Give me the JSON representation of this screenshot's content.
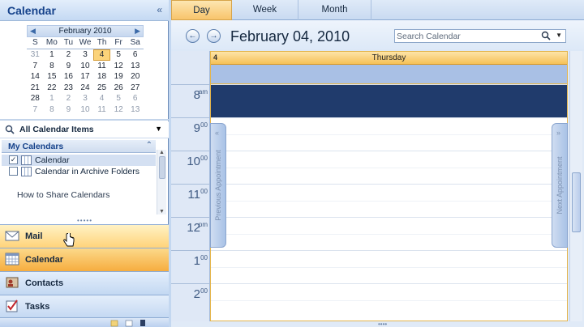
{
  "nav": {
    "title": "Calendar",
    "collapse_glyph": "«",
    "mini_calendar": {
      "month_label": "February 2010",
      "prev_glyph": "◀",
      "next_glyph": "▶",
      "dow": [
        "S",
        "Mo",
        "Tu",
        "We",
        "Th",
        "Fr",
        "Sa"
      ],
      "weeks": [
        [
          {
            "d": "31",
            "o": true
          },
          {
            "d": "1"
          },
          {
            "d": "2"
          },
          {
            "d": "3"
          },
          {
            "d": "4",
            "sel": true
          },
          {
            "d": "5"
          },
          {
            "d": "6"
          }
        ],
        [
          {
            "d": "7"
          },
          {
            "d": "8"
          },
          {
            "d": "9"
          },
          {
            "d": "10"
          },
          {
            "d": "11"
          },
          {
            "d": "12"
          },
          {
            "d": "13"
          }
        ],
        [
          {
            "d": "14"
          },
          {
            "d": "15"
          },
          {
            "d": "16"
          },
          {
            "d": "17"
          },
          {
            "d": "18"
          },
          {
            "d": "19"
          },
          {
            "d": "20"
          }
        ],
        [
          {
            "d": "21"
          },
          {
            "d": "22"
          },
          {
            "d": "23"
          },
          {
            "d": "24"
          },
          {
            "d": "25"
          },
          {
            "d": "26"
          },
          {
            "d": "27"
          }
        ],
        [
          {
            "d": "28"
          },
          {
            "d": "1",
            "o": true
          },
          {
            "d": "2",
            "o": true
          },
          {
            "d": "3",
            "o": true
          },
          {
            "d": "4",
            "o": true
          },
          {
            "d": "5",
            "o": true
          },
          {
            "d": "6",
            "o": true
          }
        ],
        [
          {
            "d": "7",
            "o": true
          },
          {
            "d": "8",
            "o": true
          },
          {
            "d": "9",
            "o": true
          },
          {
            "d": "10",
            "o": true
          },
          {
            "d": "11",
            "o": true
          },
          {
            "d": "12",
            "o": true
          },
          {
            "d": "13",
            "o": true
          }
        ]
      ]
    },
    "all_items_label": "All Calendar Items",
    "all_items_drop": "▼",
    "my_calendars_label": "My Calendars",
    "my_calendars_toggle": "⌃",
    "calendars": [
      {
        "name": "Calendar",
        "checked": "✓"
      },
      {
        "name": "Calendar in Archive Folders",
        "checked": ""
      }
    ],
    "share_link": "How to Share Calendars",
    "grip": "•••••",
    "buttons": [
      {
        "label": "Mail"
      },
      {
        "label": "Calendar"
      },
      {
        "label": "Contacts"
      },
      {
        "label": "Tasks"
      }
    ]
  },
  "tabs": [
    "Day",
    "Week",
    "Month"
  ],
  "date_bar": {
    "title": "February 04, 2010",
    "back_glyph": "←",
    "forward_glyph": "→"
  },
  "search": {
    "placeholder": "Search Calendar",
    "drop": "▼"
  },
  "day": {
    "number": "4",
    "name": "Thursday",
    "hours": [
      {
        "num": "8",
        "ampm": "am"
      },
      {
        "num": "9",
        "ampm": "00"
      },
      {
        "num": "10",
        "ampm": "00"
      },
      {
        "num": "11",
        "ampm": "00"
      },
      {
        "num": "12",
        "ampm": "pm"
      },
      {
        "num": "1",
        "ampm": "00"
      },
      {
        "num": "2",
        "ampm": "00"
      }
    ],
    "previous_appointment": "Previous Appointment",
    "next_appointment": "Next Appointment",
    "prev_arrow": "«",
    "next_arrow": "»"
  },
  "colors": {
    "accent": "#f6ad3f",
    "selected_slot": "#203b6c",
    "all_day_band": "#a9c0e5"
  }
}
